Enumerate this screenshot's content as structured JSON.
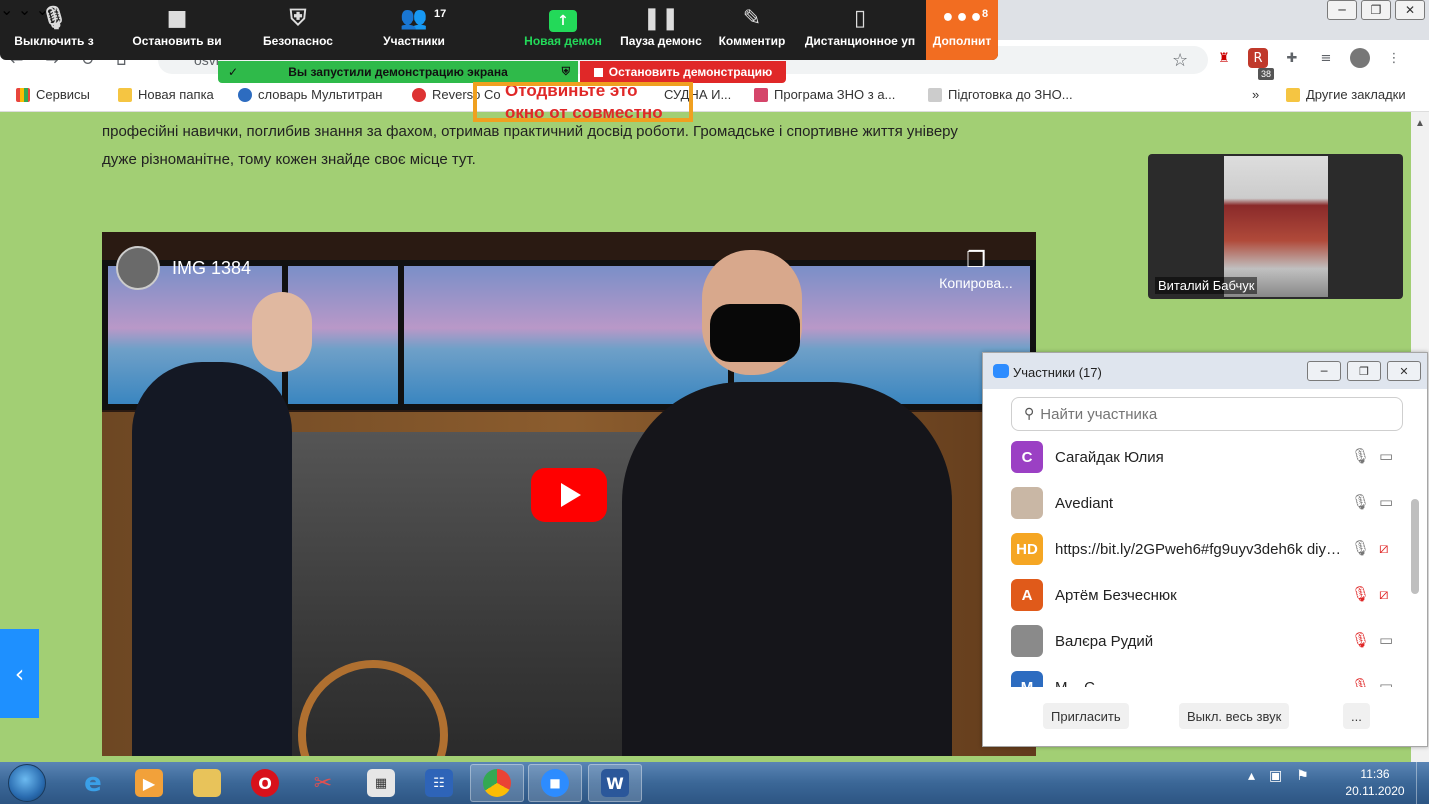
{
  "zoom_toolbar": {
    "mute_label": "Выключить з",
    "video_label": "Остановить ви",
    "security_label": "Безопаснос",
    "participants_label": "Участники",
    "participants_count": "17",
    "new_share_label": "Новая демон",
    "pause_share_label": "Пауза демонс",
    "annotate_label": "Комментир",
    "remote_control_label": "Дистанционное уп",
    "more_label": "Дополнит",
    "more_badge": "8"
  },
  "share_banner": {
    "text": "Вы запустили демонстрацию экрана",
    "stop_label": "Остановить демонстрацию"
  },
  "tooltip": {
    "line1": "Отодвиньте это",
    "line2": "окно от совместно"
  },
  "browser": {
    "url": "osvi",
    "ext_badge": "38"
  },
  "bookmarks": {
    "apps": "Сервисы",
    "items": [
      "Новая папка",
      "словарь Мультитран",
      "Reverso Co",
      "СУДНА И...",
      "Програма ЗНО з а...",
      "Підготовка до ЗНО..."
    ],
    "overflow": "»",
    "other": "Другие закладки"
  },
  "page": {
    "paragraph_line1": "професійні навички, поглибив знання за фахом, отримав практичний досвід роботи. Громадське і спортивне життя універу",
    "paragraph_line2": "дуже різноманітне, тому кожен знайде своє місце тут."
  },
  "video": {
    "title": "IMG 1384",
    "copy_label": "Копирова..."
  },
  "self_view": {
    "name": "Виталий Бабчук"
  },
  "participants_panel": {
    "title": "Участники (17)",
    "search_placeholder": "Найти участника",
    "participants": [
      {
        "initials": "C",
        "name": "Сагайдак Юлия",
        "avatar_color": "#9b40c4",
        "mic_muted": false,
        "cam_off": false
      },
      {
        "initials": "",
        "name": "Avediant",
        "avatar_color": "#c9b7a5",
        "mic_muted": false,
        "cam_off": false
      },
      {
        "initials": "HD",
        "name": "https://bit.ly/2GPweh6#fg9uyv3deh6k diy2...",
        "avatar_color": "#f5a623",
        "mic_muted": false,
        "cam_off": true
      },
      {
        "initials": "А",
        "name": "Артём Безчеснюк",
        "avatar_color": "#e05a1a",
        "mic_muted": true,
        "cam_off": true
      },
      {
        "initials": "",
        "name": "Валєра Рудий",
        "avatar_color": "#8a8a8a",
        "mic_muted": true,
        "cam_off": false
      },
      {
        "initials": "M",
        "name": "М... С...",
        "avatar_color": "#2d6cc0",
        "mic_muted": true,
        "cam_off": false
      }
    ],
    "invite_label": "Пригласить",
    "mute_all_label": "Выкл. весь звук",
    "more_label": "..."
  },
  "taskbar": {
    "time": "11:36",
    "date": "20.11.2020"
  }
}
